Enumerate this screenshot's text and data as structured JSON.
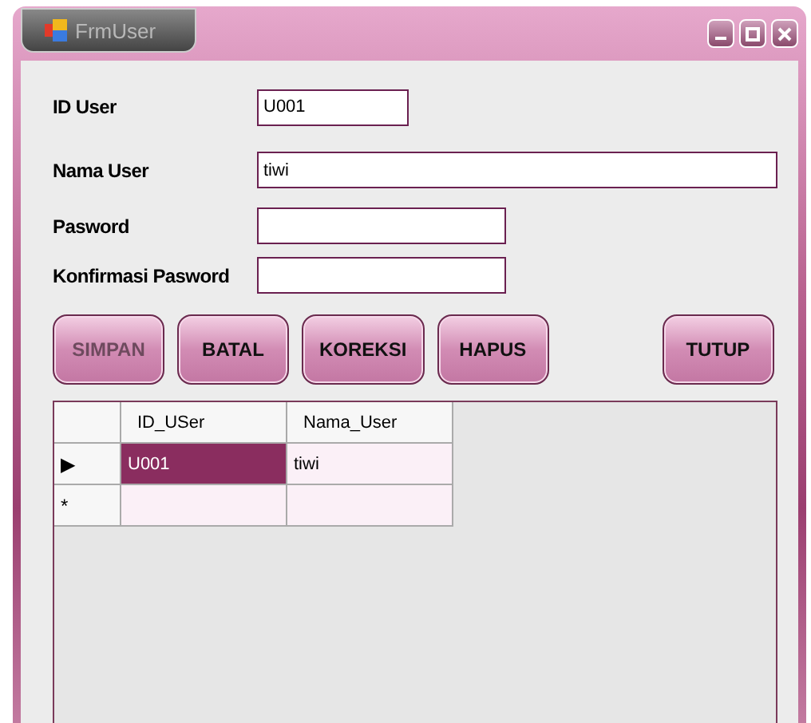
{
  "window": {
    "title": "FrmUser"
  },
  "fields": [
    {
      "label": "ID User",
      "value": "U001"
    },
    {
      "label": "Nama User",
      "value": "tiwi"
    },
    {
      "label": "Pasword"
    },
    {
      "label": "Konfirmasi Pasword"
    }
  ],
  "buttons": [
    {
      "label": "SIMPAN",
      "disabled": true
    },
    {
      "label": "BATAL",
      "disabled": false
    },
    {
      "label": "KOREKSI",
      "disabled": false
    },
    {
      "label": "HAPUS",
      "disabled": false
    },
    {
      "label": "TUTUP",
      "disabled": false
    }
  ],
  "table": {
    "columns": [
      "ID_USer",
      "Nama_User"
    ],
    "rows": [
      {
        "marker": "▶",
        "cells": [
          "U001",
          "tiwi"
        ],
        "selected": true
      },
      {
        "marker": "*",
        "cells": [],
        "selected": false
      }
    ]
  }
}
